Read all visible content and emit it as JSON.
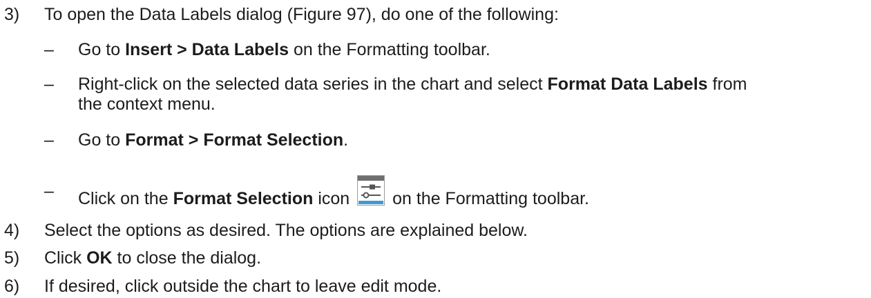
{
  "steps": [
    {
      "number": "3)",
      "text": "To open the Data Labels dialog (Figure 97), do one of the following:"
    },
    {
      "number": "4)",
      "text": "Select the options as desired. The options are explained below."
    },
    {
      "number": "5)",
      "pre": "Click ",
      "bold": "OK",
      "post": " to close the dialog."
    },
    {
      "number": "6)",
      "text": "If desired, click outside the chart to leave edit mode."
    }
  ],
  "bullets": {
    "dash": "–",
    "b1": {
      "pre": "Go to ",
      "bold": "Insert > Data Labels",
      "post": " on the Formatting toolbar."
    },
    "b2": {
      "pre": "Right-click on the selected data series in the chart and select ",
      "bold": "Format Data Labels",
      "post": " from",
      "line2": "the context menu."
    },
    "b3": {
      "pre": "Go to ",
      "bold": "Format > Format Selection",
      "post": "."
    },
    "b4": {
      "pre": "Click on the ",
      "bold": "Format Selection",
      "mid": " icon ",
      "icon": "format-selection-icon",
      "post": " on the Formatting toolbar."
    }
  }
}
